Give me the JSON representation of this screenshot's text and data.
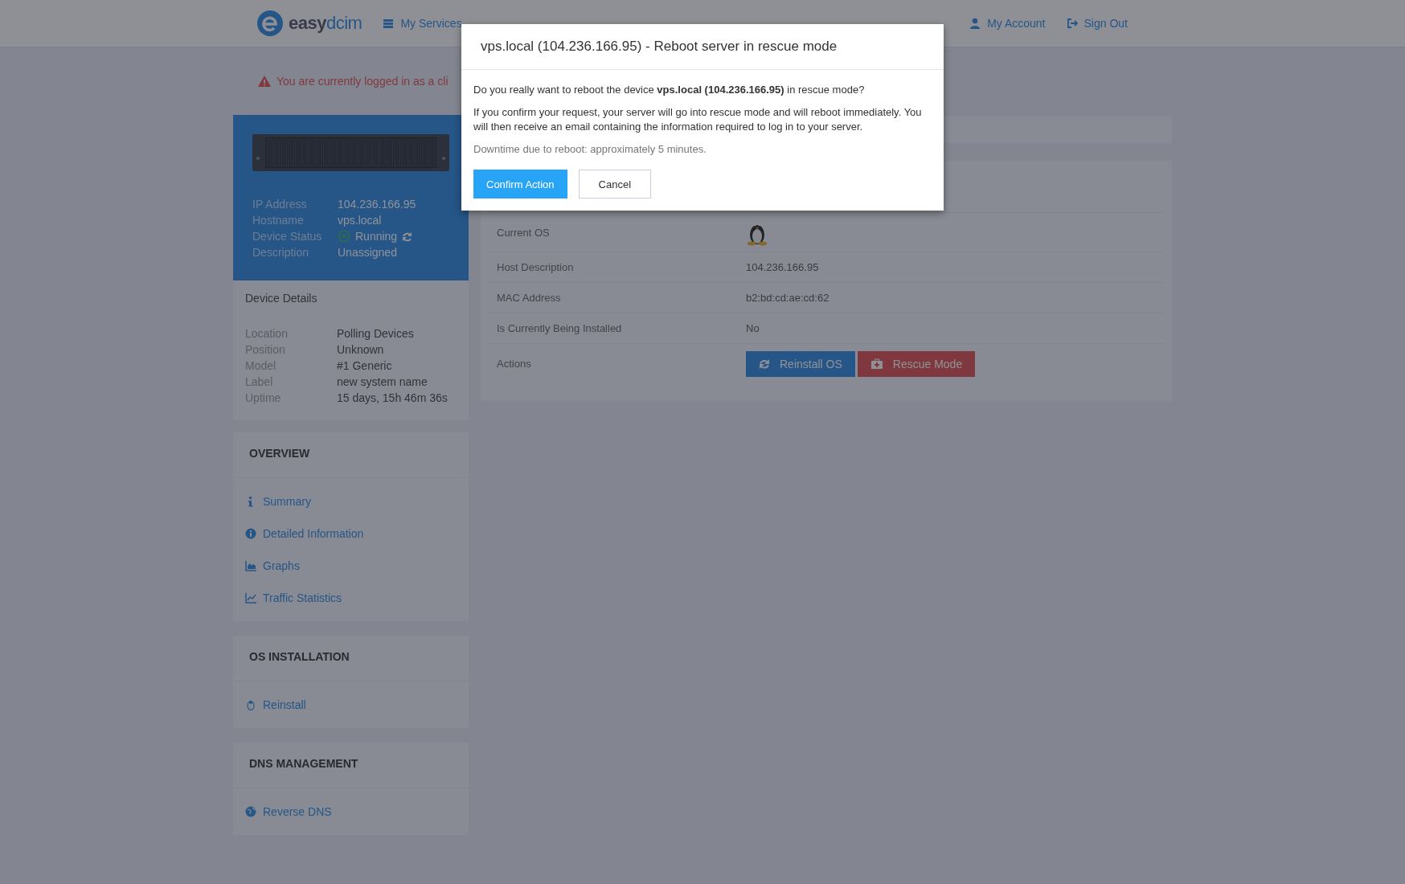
{
  "nav": {
    "brand": {
      "first": "easy",
      "second": "dcim"
    },
    "links": [
      {
        "label": "My Services"
      },
      {
        "label": "My Account"
      },
      {
        "label": "Sign Out"
      }
    ]
  },
  "alert": {
    "text": "You are currently logged in as a cli"
  },
  "device": {
    "fields": [
      {
        "label": "IP Address",
        "value": "104.236.166.95",
        "kind": "text"
      },
      {
        "label": "Hostname",
        "value": "vps.local",
        "kind": "text"
      },
      {
        "label": "Device Status",
        "value": "Running",
        "kind": "status"
      },
      {
        "label": "Description",
        "value": "Unassigned",
        "kind": "text"
      }
    ]
  },
  "device_details": {
    "title": "Device Details",
    "fields": [
      {
        "label": "Location",
        "value": "Polling Devices"
      },
      {
        "label": "Position",
        "value": "Unknown"
      },
      {
        "label": "Model",
        "value": "#1 Generic"
      },
      {
        "label": "Label",
        "value": "new system name"
      },
      {
        "label": "Uptime",
        "value": "15 days, 15h 46m 36s"
      }
    ]
  },
  "sidebar": [
    {
      "title": "OVERVIEW",
      "items": [
        {
          "label": "Summary"
        },
        {
          "label": "Detailed Information"
        },
        {
          "label": "Graphs"
        },
        {
          "label": "Traffic Statistics"
        }
      ]
    },
    {
      "title": "OS INSTALLATION",
      "items": [
        {
          "label": "Reinstall"
        }
      ]
    },
    {
      "title": "DNS MANAGEMENT",
      "items": [
        {
          "label": "Reverse DNS"
        }
      ]
    }
  ],
  "details": {
    "rows": [
      {
        "label": "Current OS",
        "kind": "os"
      },
      {
        "label": "Host Description",
        "kind": "text",
        "value": "104.236.166.95"
      },
      {
        "label": "MAC Address",
        "kind": "text",
        "value": "b2:bd:cd:ae:cd:62"
      },
      {
        "label": "Is Currently Being Installed",
        "kind": "text",
        "value": "No"
      },
      {
        "label": "Actions",
        "kind": "actions",
        "buttons": [
          {
            "label": "Reinstall OS",
            "kind": "primary"
          },
          {
            "label": "Rescue Mode",
            "kind": "danger"
          }
        ]
      }
    ]
  },
  "modal": {
    "title": "vps.local (104.236.166.95) - Reboot server in rescue mode",
    "paragraphs": [
      "Do you really want to reboot the device **vps.local (104.236.166.95)** in rescue mode?",
      "If you confirm your request, your server will go into rescue mode and will reboot immediately. You will then receive an email containing the information required to log in to your server."
    ],
    "note": "Downtime due to reboot: approximately 5 minutes.",
    "buttons": [
      {
        "label": "Confirm Action",
        "kind": "primary"
      },
      {
        "label": "Cancel",
        "kind": "default"
      }
    ]
  }
}
